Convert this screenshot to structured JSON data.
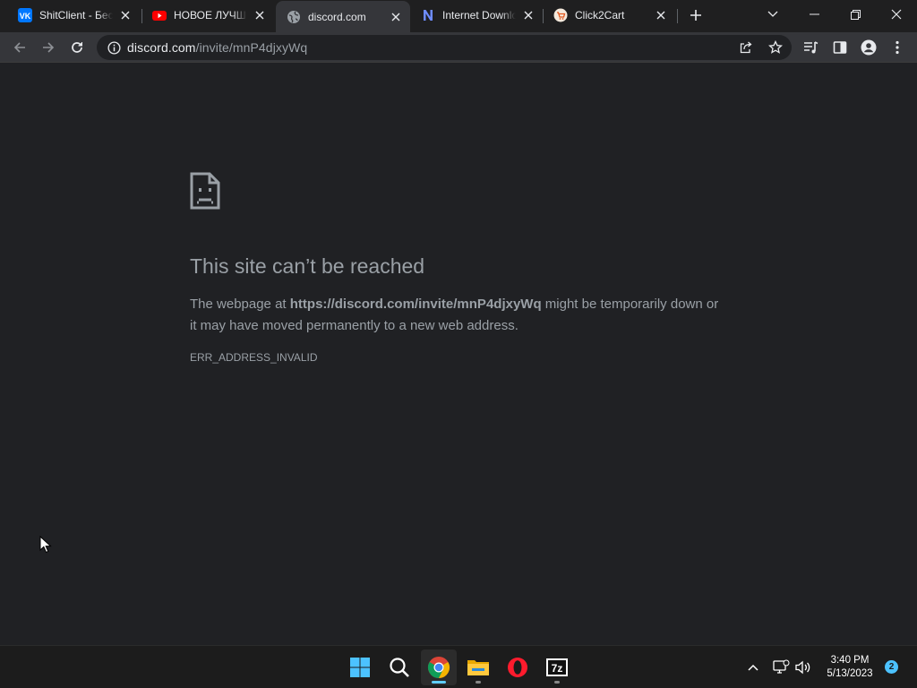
{
  "tabs": [
    {
      "title": "ShitClient - Бесп",
      "icon": "vk-icon",
      "active": false
    },
    {
      "title": "НОВОЕ ЛУЧШЕЕ",
      "icon": "youtube-icon",
      "active": false
    },
    {
      "title": "discord.com",
      "icon": "globe-icon",
      "active": true
    },
    {
      "title": "Internet Download",
      "icon": "n-logo-icon",
      "active": false
    },
    {
      "title": "Click2Cart",
      "icon": "click2cart-icon",
      "active": false
    }
  ],
  "omnibox": {
    "host": "discord.com",
    "path": "/invite/mnP4djxyWq"
  },
  "error": {
    "title": "This site can’t be reached",
    "desc_prefix": "The webpage at ",
    "url": "https://discord.com/invite/mnP4djxyWq",
    "desc_suffix": " might be temporarily down or it may have moved permanently to a new web address.",
    "code": "ERR_ADDRESS_INVALID"
  },
  "taskbar": {
    "apps": [
      "start-icon",
      "search-icon",
      "chrome-icon",
      "file-explorer-icon",
      "opera-icon",
      "7zip-icon"
    ],
    "time": "3:40 PM",
    "date": "5/13/2023",
    "notification_count": "2",
    "sevenzip_label": "7z"
  },
  "colors": {
    "page_bg": "#202124",
    "tab_active": "#35363a",
    "accent": "#60cdff"
  }
}
